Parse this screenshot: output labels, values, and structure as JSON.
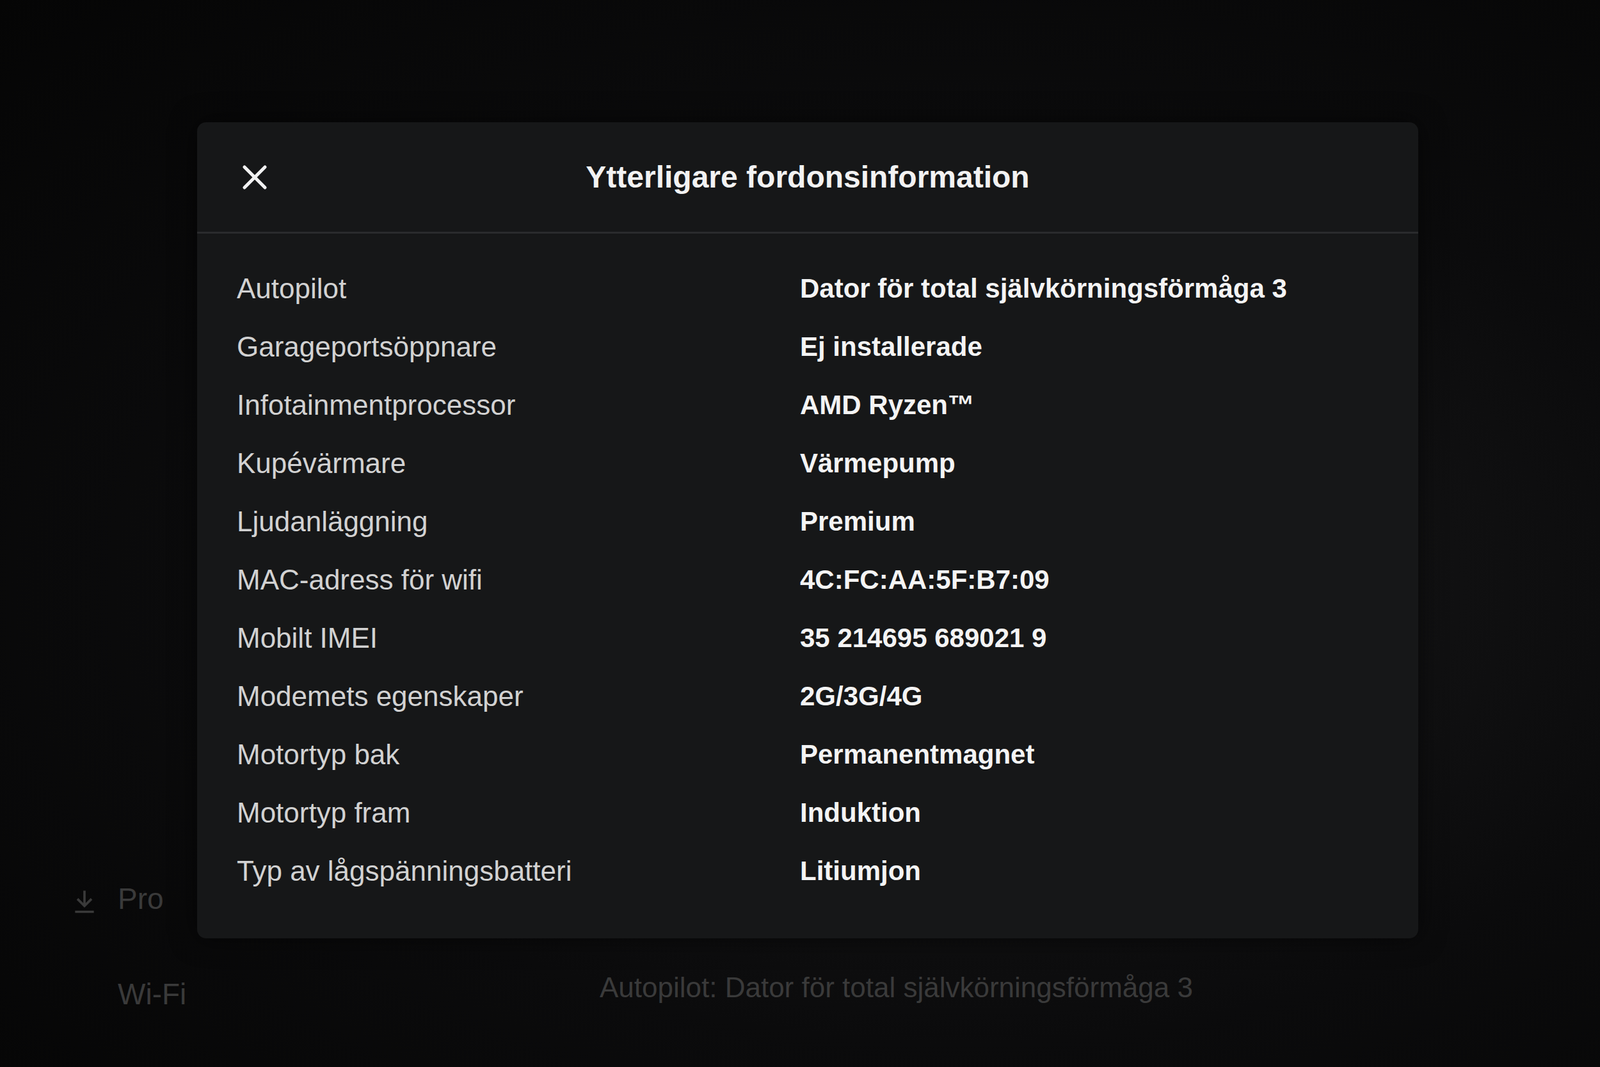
{
  "dialog": {
    "title": "Ytterligare fordonsinformation",
    "rows": [
      {
        "label": "Autopilot",
        "value": "Dator för total självkörningsförmåga 3"
      },
      {
        "label": "Garageportsöppnare",
        "value": "Ej installerade"
      },
      {
        "label": "Infotainmentprocessor",
        "value": "AMD Ryzen™"
      },
      {
        "label": "Kupévärmare",
        "value": "Värmepump"
      },
      {
        "label": "Ljudanläggning",
        "value": "Premium"
      },
      {
        "label": "MAC-adress för wifi",
        "value": "4C:FC:AA:5F:B7:09"
      },
      {
        "label": "Mobilt IMEI",
        "value": "35 214695 689021 9"
      },
      {
        "label": "Modemets egenskaper",
        "value": "2G/3G/4G"
      },
      {
        "label": "Motortyp bak",
        "value": "Permanentmagnet"
      },
      {
        "label": "Motortyp fram",
        "value": "Induktion"
      },
      {
        "label": "Typ av lågspänningsbatteri",
        "value": "Litiumjon"
      }
    ]
  },
  "background": {
    "sidebar": [
      {
        "label": "Pro"
      },
      {
        "label": "Wi-Fi"
      }
    ],
    "line": "Autopilot: Dator för total självkörningsförmåga 3"
  }
}
